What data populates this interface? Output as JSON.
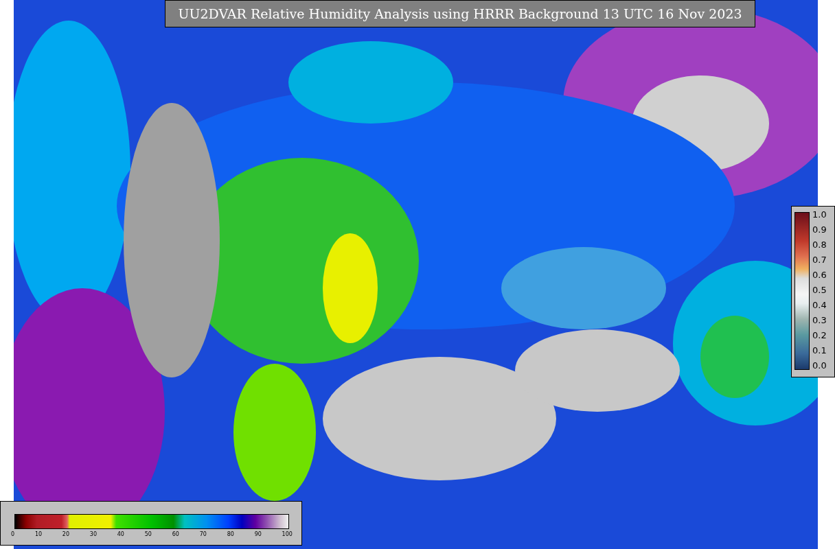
{
  "title": "UU2DVAR Relative Humidity Analysis using HRRR Background 13 UTC 16 Nov 2023",
  "bottom_colorbar": {
    "ticks": [
      "0",
      "10",
      "20",
      "30",
      "40",
      "50",
      "60",
      "70",
      "80",
      "90",
      "100"
    ]
  },
  "right_colorbar": {
    "ticks": [
      "1.0",
      "0.9",
      "0.8",
      "0.7",
      "0.6",
      "0.5",
      "0.4",
      "0.3",
      "0.2",
      "0.1",
      "0.0"
    ]
  }
}
